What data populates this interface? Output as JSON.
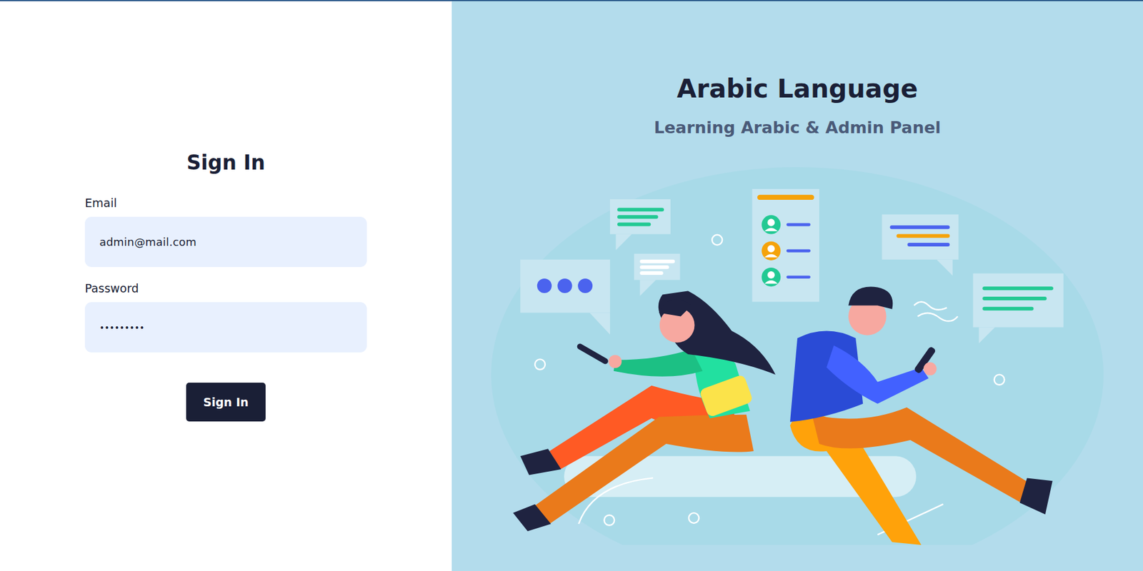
{
  "signin": {
    "title": "Sign In",
    "fields": [
      {
        "label": "Email",
        "value": "admin@mail.com",
        "kind": "text"
      },
      {
        "label": "Password",
        "value": "•••••••••",
        "kind": "password"
      }
    ],
    "button": "Sign In"
  },
  "hero": {
    "title": "Arabic Language",
    "subtitle": "Learning Arabic & Admin Panel"
  }
}
